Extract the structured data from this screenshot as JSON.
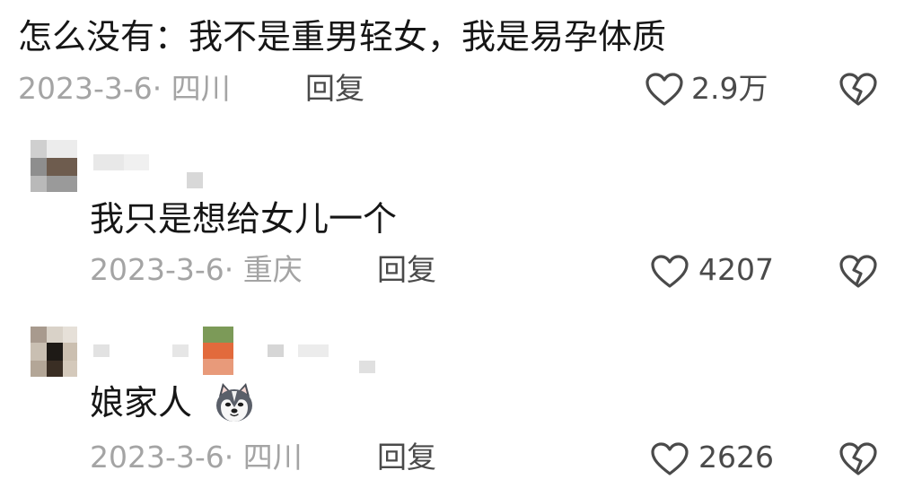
{
  "comments": [
    {
      "text": "怎么没有：我不是重男轻女，我是易孕体质",
      "meta": "2023-3-6· 四川",
      "reply_label": "回复",
      "like_count": "2.9万"
    },
    {
      "text": "我只是想给女儿一个",
      "meta": "2023-3-6· 重庆",
      "reply_label": "回复",
      "like_count": "4207"
    },
    {
      "text": "娘家人",
      "emoji": "husky-dog-face",
      "meta": "2023-3-6· 四川",
      "reply_label": "回复",
      "like_count": "2626"
    }
  ],
  "icons": {
    "like": "heart-outline-icon",
    "dislike": "broken-heart-icon"
  },
  "colors": {
    "text": "#161616",
    "meta": "#a4a4a4",
    "action": "#4a4a4a"
  }
}
